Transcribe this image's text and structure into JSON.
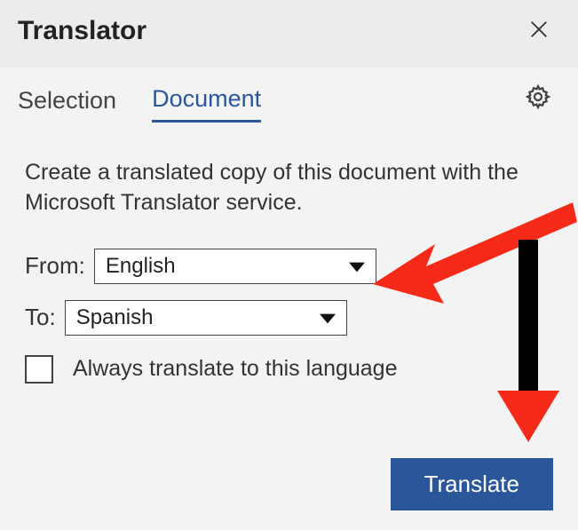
{
  "header": {
    "title": "Translator"
  },
  "tabs": {
    "selection": "Selection",
    "document": "Document"
  },
  "description": "Create a translated copy of this document with the Microsoft Translator service.",
  "from": {
    "label": "From:",
    "value": "English"
  },
  "to": {
    "label": "To:",
    "value": "Spanish"
  },
  "always_translate_label": "Always translate to this language",
  "translate_button": "Translate"
}
